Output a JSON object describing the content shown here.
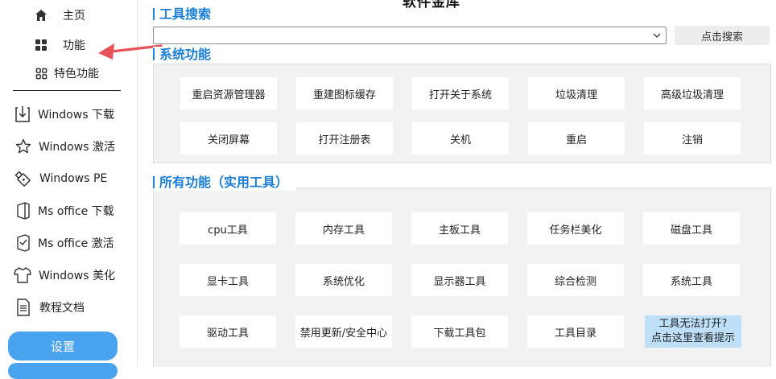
{
  "app": {
    "title": "软件金库"
  },
  "sidebar": {
    "items": [
      {
        "label": "主页",
        "icon": "home-icon"
      },
      {
        "label": "功能",
        "icon": "grid-icon"
      },
      {
        "label": "特色功能",
        "icon": "grid-outline-icon"
      },
      {
        "label": "Windows 下载",
        "icon": "download-icon"
      },
      {
        "label": "Windows 激活",
        "icon": "star-icon"
      },
      {
        "label": "Windows PE",
        "icon": "usb-drive-icon"
      },
      {
        "label": "Ms office 下载",
        "icon": "office-icon"
      },
      {
        "label": "Ms office 激活",
        "icon": "office-activate-icon"
      },
      {
        "label": "Windows 美化",
        "icon": "tshirt-icon"
      },
      {
        "label": "教程文档",
        "icon": "document-icon"
      }
    ],
    "settings_label": "设置"
  },
  "search": {
    "heading": "工具搜索",
    "value": "",
    "placeholder": "",
    "button_label": "点击搜索"
  },
  "system": {
    "heading": "系统功能",
    "buttons": [
      "重启资源管理器",
      "重建图标缓存",
      "打开关于系统",
      "垃圾清理",
      "高级垃圾清理",
      "关闭屏幕",
      "打开注册表",
      "关机",
      "重启",
      "注销"
    ]
  },
  "all_tools": {
    "heading": "所有功能（实用工具）",
    "buttons": [
      "cpu工具",
      "内存工具",
      "主板工具",
      "任务栏美化",
      "磁盘工具",
      "显卡工具",
      "系统优化",
      "显示器工具",
      "综合检测",
      "系统工具",
      "驱动工具",
      "禁用更新/安全中心",
      "下载工具包",
      "工具目录"
    ],
    "help_line1": "工具无法打开?",
    "help_line2": "点击这里查看提示"
  },
  "colors": {
    "accent": "#1b7fd6",
    "pill": "#4aa3ef",
    "arrow": "#e8525a",
    "help_bg": "#bde0f8"
  }
}
